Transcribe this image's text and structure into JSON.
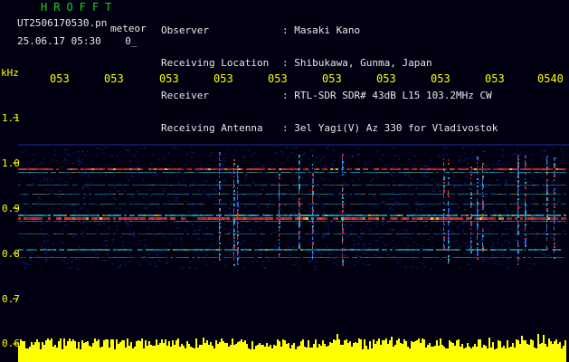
{
  "header": {
    "app_title": "HROFFT",
    "filename": "UT2506170530.pn",
    "filename_suffix": "meteor",
    "datetime": "25.06.17 05:30",
    "status": "0_"
  },
  "info": [
    {
      "key": "Observer",
      "value": ": Masaki Kano"
    },
    {
      "key": "Receiving Location",
      "value": ": Shibukawa, Gunma, Japan"
    },
    {
      "key": "Receiver",
      "value": ": RTL-SDR SDR# 43dB L15 103.2MHz CW"
    },
    {
      "key": "Receiving Antenna",
      "value": ": 3el Yagi(V) Az 330 for Vladivostok"
    }
  ],
  "axis": {
    "unit": "kHz",
    "y_labels": [
      "1.1",
      "1.0",
      "0.9",
      "0.8",
      "0.7",
      "0.6"
    ],
    "x_labels": [
      "053",
      "053",
      "053",
      "053",
      "053",
      "053",
      "053",
      "053",
      "053",
      "0540"
    ]
  },
  "colors": {
    "background": "#000010",
    "noise": "#1428a0",
    "signal_strong": "#ff3333",
    "signal_mid": "#22ccdd",
    "level_bar": "#ffff00",
    "axis_text": "#ffff00",
    "title": "#22cc22"
  }
}
